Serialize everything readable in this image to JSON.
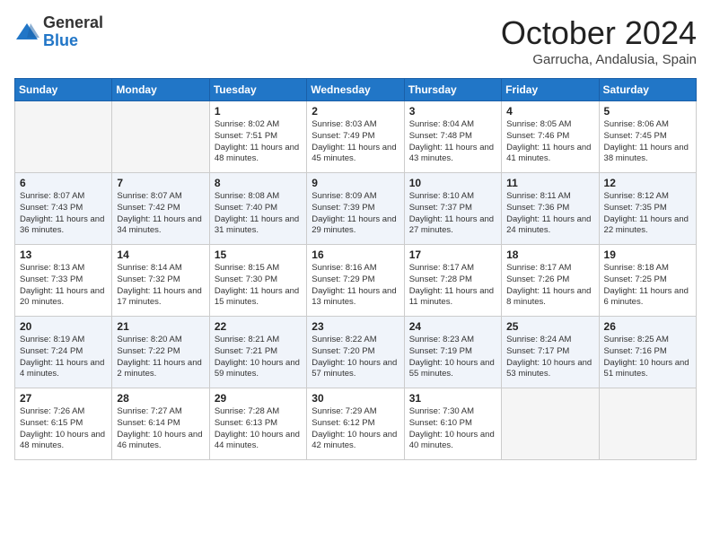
{
  "logo": {
    "general": "General",
    "blue": "Blue"
  },
  "title": {
    "month": "October 2024",
    "location": "Garrucha, Andalusia, Spain"
  },
  "weekdays": [
    "Sunday",
    "Monday",
    "Tuesday",
    "Wednesday",
    "Thursday",
    "Friday",
    "Saturday"
  ],
  "weeks": [
    [
      {
        "day": "",
        "info": ""
      },
      {
        "day": "",
        "info": ""
      },
      {
        "day": "1",
        "info": "Sunrise: 8:02 AM\nSunset: 7:51 PM\nDaylight: 11 hours and 48 minutes."
      },
      {
        "day": "2",
        "info": "Sunrise: 8:03 AM\nSunset: 7:49 PM\nDaylight: 11 hours and 45 minutes."
      },
      {
        "day": "3",
        "info": "Sunrise: 8:04 AM\nSunset: 7:48 PM\nDaylight: 11 hours and 43 minutes."
      },
      {
        "day": "4",
        "info": "Sunrise: 8:05 AM\nSunset: 7:46 PM\nDaylight: 11 hours and 41 minutes."
      },
      {
        "day": "5",
        "info": "Sunrise: 8:06 AM\nSunset: 7:45 PM\nDaylight: 11 hours and 38 minutes."
      }
    ],
    [
      {
        "day": "6",
        "info": "Sunrise: 8:07 AM\nSunset: 7:43 PM\nDaylight: 11 hours and 36 minutes."
      },
      {
        "day": "7",
        "info": "Sunrise: 8:07 AM\nSunset: 7:42 PM\nDaylight: 11 hours and 34 minutes."
      },
      {
        "day": "8",
        "info": "Sunrise: 8:08 AM\nSunset: 7:40 PM\nDaylight: 11 hours and 31 minutes."
      },
      {
        "day": "9",
        "info": "Sunrise: 8:09 AM\nSunset: 7:39 PM\nDaylight: 11 hours and 29 minutes."
      },
      {
        "day": "10",
        "info": "Sunrise: 8:10 AM\nSunset: 7:37 PM\nDaylight: 11 hours and 27 minutes."
      },
      {
        "day": "11",
        "info": "Sunrise: 8:11 AM\nSunset: 7:36 PM\nDaylight: 11 hours and 24 minutes."
      },
      {
        "day": "12",
        "info": "Sunrise: 8:12 AM\nSunset: 7:35 PM\nDaylight: 11 hours and 22 minutes."
      }
    ],
    [
      {
        "day": "13",
        "info": "Sunrise: 8:13 AM\nSunset: 7:33 PM\nDaylight: 11 hours and 20 minutes."
      },
      {
        "day": "14",
        "info": "Sunrise: 8:14 AM\nSunset: 7:32 PM\nDaylight: 11 hours and 17 minutes."
      },
      {
        "day": "15",
        "info": "Sunrise: 8:15 AM\nSunset: 7:30 PM\nDaylight: 11 hours and 15 minutes."
      },
      {
        "day": "16",
        "info": "Sunrise: 8:16 AM\nSunset: 7:29 PM\nDaylight: 11 hours and 13 minutes."
      },
      {
        "day": "17",
        "info": "Sunrise: 8:17 AM\nSunset: 7:28 PM\nDaylight: 11 hours and 11 minutes."
      },
      {
        "day": "18",
        "info": "Sunrise: 8:17 AM\nSunset: 7:26 PM\nDaylight: 11 hours and 8 minutes."
      },
      {
        "day": "19",
        "info": "Sunrise: 8:18 AM\nSunset: 7:25 PM\nDaylight: 11 hours and 6 minutes."
      }
    ],
    [
      {
        "day": "20",
        "info": "Sunrise: 8:19 AM\nSunset: 7:24 PM\nDaylight: 11 hours and 4 minutes."
      },
      {
        "day": "21",
        "info": "Sunrise: 8:20 AM\nSunset: 7:22 PM\nDaylight: 11 hours and 2 minutes."
      },
      {
        "day": "22",
        "info": "Sunrise: 8:21 AM\nSunset: 7:21 PM\nDaylight: 10 hours and 59 minutes."
      },
      {
        "day": "23",
        "info": "Sunrise: 8:22 AM\nSunset: 7:20 PM\nDaylight: 10 hours and 57 minutes."
      },
      {
        "day": "24",
        "info": "Sunrise: 8:23 AM\nSunset: 7:19 PM\nDaylight: 10 hours and 55 minutes."
      },
      {
        "day": "25",
        "info": "Sunrise: 8:24 AM\nSunset: 7:17 PM\nDaylight: 10 hours and 53 minutes."
      },
      {
        "day": "26",
        "info": "Sunrise: 8:25 AM\nSunset: 7:16 PM\nDaylight: 10 hours and 51 minutes."
      }
    ],
    [
      {
        "day": "27",
        "info": "Sunrise: 7:26 AM\nSunset: 6:15 PM\nDaylight: 10 hours and 48 minutes."
      },
      {
        "day": "28",
        "info": "Sunrise: 7:27 AM\nSunset: 6:14 PM\nDaylight: 10 hours and 46 minutes."
      },
      {
        "day": "29",
        "info": "Sunrise: 7:28 AM\nSunset: 6:13 PM\nDaylight: 10 hours and 44 minutes."
      },
      {
        "day": "30",
        "info": "Sunrise: 7:29 AM\nSunset: 6:12 PM\nDaylight: 10 hours and 42 minutes."
      },
      {
        "day": "31",
        "info": "Sunrise: 7:30 AM\nSunset: 6:10 PM\nDaylight: 10 hours and 40 minutes."
      },
      {
        "day": "",
        "info": ""
      },
      {
        "day": "",
        "info": ""
      }
    ]
  ]
}
